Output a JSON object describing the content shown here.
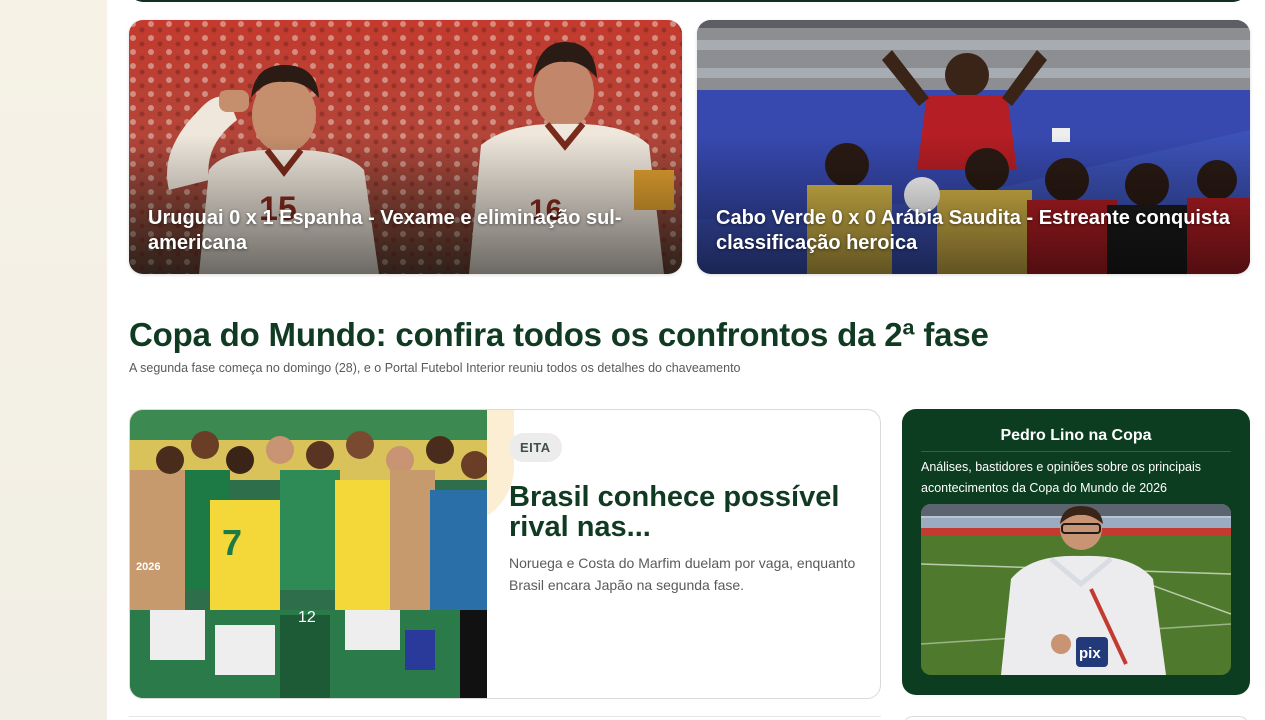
{
  "top_cards": [
    {
      "caption": "Uruguai 0 x 1 Espanha - Vexame e eliminação sul-americana",
      "photo_icon": "football-players-photo"
    },
    {
      "caption": "Cabo Verde 0 x 0 Arábia Saudita - Estreante conquista classificação heroica",
      "photo_icon": "football-celebration-photo"
    }
  ],
  "section": {
    "title": "Copa do Mundo: confira todos os confrontos da 2ª fase",
    "subtitle": "A segunda fase começa no domingo (28), e o Portal Futebol Interior reuniu todos os detalhes do chaveamento"
  },
  "feature": {
    "tag": "EITA",
    "title": "Brasil conhece possível rival nas...",
    "description": "Noruega e Costa do Marfim duelam por vaga, enquanto Brasil encara Japão na segunda fase."
  },
  "promo": {
    "title": "Pedro Lino na Copa",
    "description": "Análises, bastidores e opiniões sobre os principais acontecimentos da Copa do Mundo de 2026"
  },
  "colors": {
    "brand_green": "#103a22",
    "promo_bg": "#0d3d20"
  }
}
